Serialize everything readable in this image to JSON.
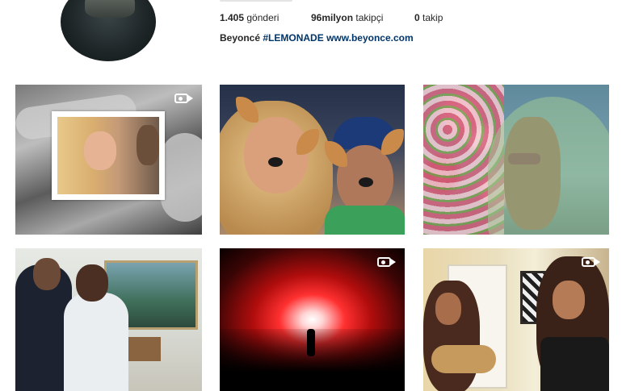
{
  "profile": {
    "stats": {
      "posts_count": "1.405",
      "posts_label": "gönderi",
      "followers_count": "96milyon",
      "followers_label": "takipçi",
      "following_count": "0",
      "following_label": "takip"
    },
    "bio": {
      "name": "Beyoncé",
      "hashtag": "#LEMONADE",
      "link": "www.beyonce.com"
    }
  },
  "grid": {
    "posts": [
      {
        "type": "video"
      },
      {
        "type": "photo"
      },
      {
        "type": "photo"
      },
      {
        "type": "photo"
      },
      {
        "type": "video"
      },
      {
        "type": "video"
      }
    ]
  },
  "colors": {
    "link": "#003569",
    "text": "#262626",
    "accent": "#3897f0"
  },
  "icons": {
    "video": "video-camera-icon"
  }
}
